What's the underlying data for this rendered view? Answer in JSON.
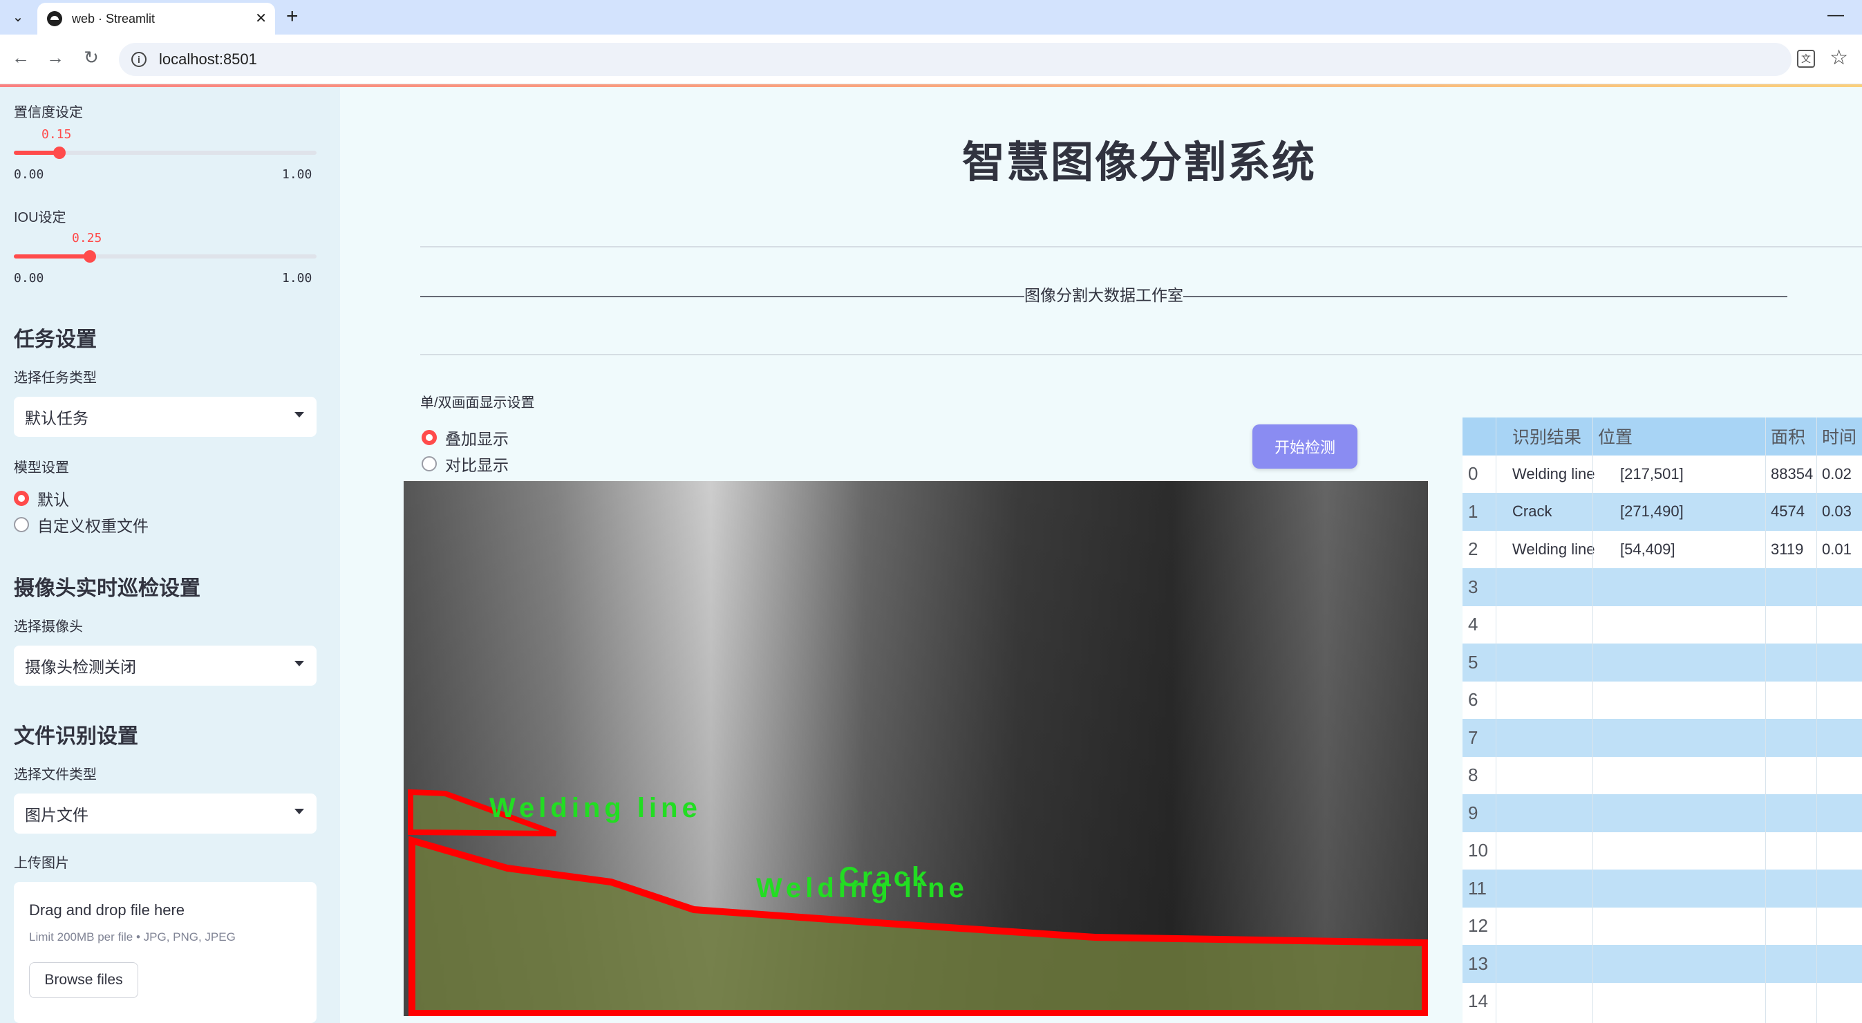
{
  "browser": {
    "tab_title": "web · Streamlit",
    "url": "localhost:8501",
    "new_tab": "+",
    "close": "✕",
    "minimize": "—"
  },
  "sidebar": {
    "confidence": {
      "label": "置信度设定",
      "value": "0.15",
      "min": "0.00",
      "max": "1.00",
      "fraction": 0.15
    },
    "iou": {
      "label": "IOU设定",
      "value": "0.25",
      "min": "0.00",
      "max": "1.00",
      "fraction": 0.25
    },
    "task_section": "任务设置",
    "task_type_label": "选择任务类型",
    "task_type_value": "默认任务",
    "model_label": "模型设置",
    "model_options": [
      "默认",
      "自定义权重文件"
    ],
    "camera_section": "摄像头实时巡检设置",
    "camera_label": "选择摄像头",
    "camera_value": "摄像头检测关闭",
    "file_section": "文件识别设置",
    "file_type_label": "选择文件类型",
    "file_type_value": "图片文件",
    "upload_label": "上传图片",
    "upload_title": "Drag and drop file here",
    "upload_limit": "Limit 200MB per file • JPG, PNG, JPEG",
    "browse_label": "Browse files"
  },
  "main": {
    "title": "智慧图像分割系统",
    "studio": "——————————————————————————————————————图像分割大数据工作室——————————————————————————————————————",
    "display_label": "单/双画面显示设置",
    "display_options": [
      "叠加显示",
      "对比显示"
    ],
    "start_button": "开始检测",
    "image_labels": [
      "Welding line",
      "Crack",
      "Welding line"
    ]
  },
  "table": {
    "headers": [
      "识别结果",
      "位置",
      "面积",
      "时间"
    ],
    "rows": [
      {
        "idx": "0",
        "result": "Welding line",
        "position": "[217,501]",
        "area": "88354",
        "time": "0.02"
      },
      {
        "idx": "1",
        "result": "Crack",
        "position": "[271,490]",
        "area": "4574",
        "time": "0.03"
      },
      {
        "idx": "2",
        "result": "Welding line",
        "position": "[54,409]",
        "area": "3119",
        "time": "0.01"
      },
      {
        "idx": "3",
        "result": "",
        "position": "",
        "area": "",
        "time": ""
      },
      {
        "idx": "4",
        "result": "",
        "position": "",
        "area": "",
        "time": ""
      },
      {
        "idx": "5",
        "result": "",
        "position": "",
        "area": "",
        "time": ""
      },
      {
        "idx": "6",
        "result": "",
        "position": "",
        "area": "",
        "time": ""
      },
      {
        "idx": "7",
        "result": "",
        "position": "",
        "area": "",
        "time": ""
      },
      {
        "idx": "8",
        "result": "",
        "position": "",
        "area": "",
        "time": ""
      },
      {
        "idx": "9",
        "result": "",
        "position": "",
        "area": "",
        "time": ""
      },
      {
        "idx": "10",
        "result": "",
        "position": "",
        "area": "",
        "time": ""
      },
      {
        "idx": "11",
        "result": "",
        "position": "",
        "area": "",
        "time": ""
      },
      {
        "idx": "12",
        "result": "",
        "position": "",
        "area": "",
        "time": ""
      },
      {
        "idx": "13",
        "result": "",
        "position": "",
        "area": "",
        "time": ""
      },
      {
        "idx": "14",
        "result": "",
        "position": "",
        "area": "",
        "time": ""
      }
    ]
  },
  "colors": {
    "accent": "#ff4b4b",
    "button": "#8a8cf2",
    "mask_outline": "#ff0000",
    "label_green": "#22dd22"
  }
}
